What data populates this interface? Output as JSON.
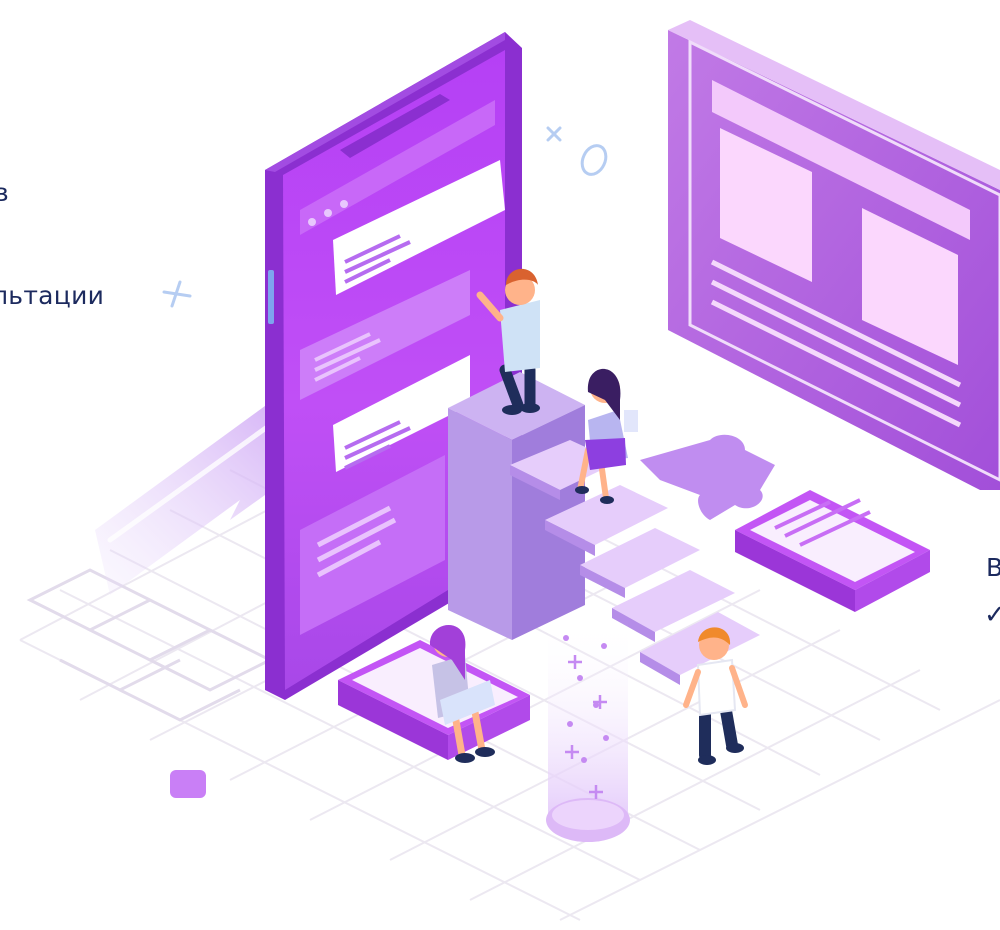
{
  "overlay_texts": {
    "line_1": "в",
    "line_2": "льтации",
    "line_3": "В",
    "line_4": "✓"
  },
  "colors": {
    "purple_dark": "#8b2fd0",
    "purple_main": "#b13ff0",
    "purple_light": "#d79cfa",
    "purple_pale": "#efd9fc",
    "lavender": "#c5a8ee",
    "grid": "#ece8f1",
    "text": "#1c2a5e",
    "accent_blue": "#b6cdf2"
  },
  "icons": [
    "plus-sparkle-icon",
    "cross-icon",
    "circle-icon",
    "check-icon"
  ]
}
